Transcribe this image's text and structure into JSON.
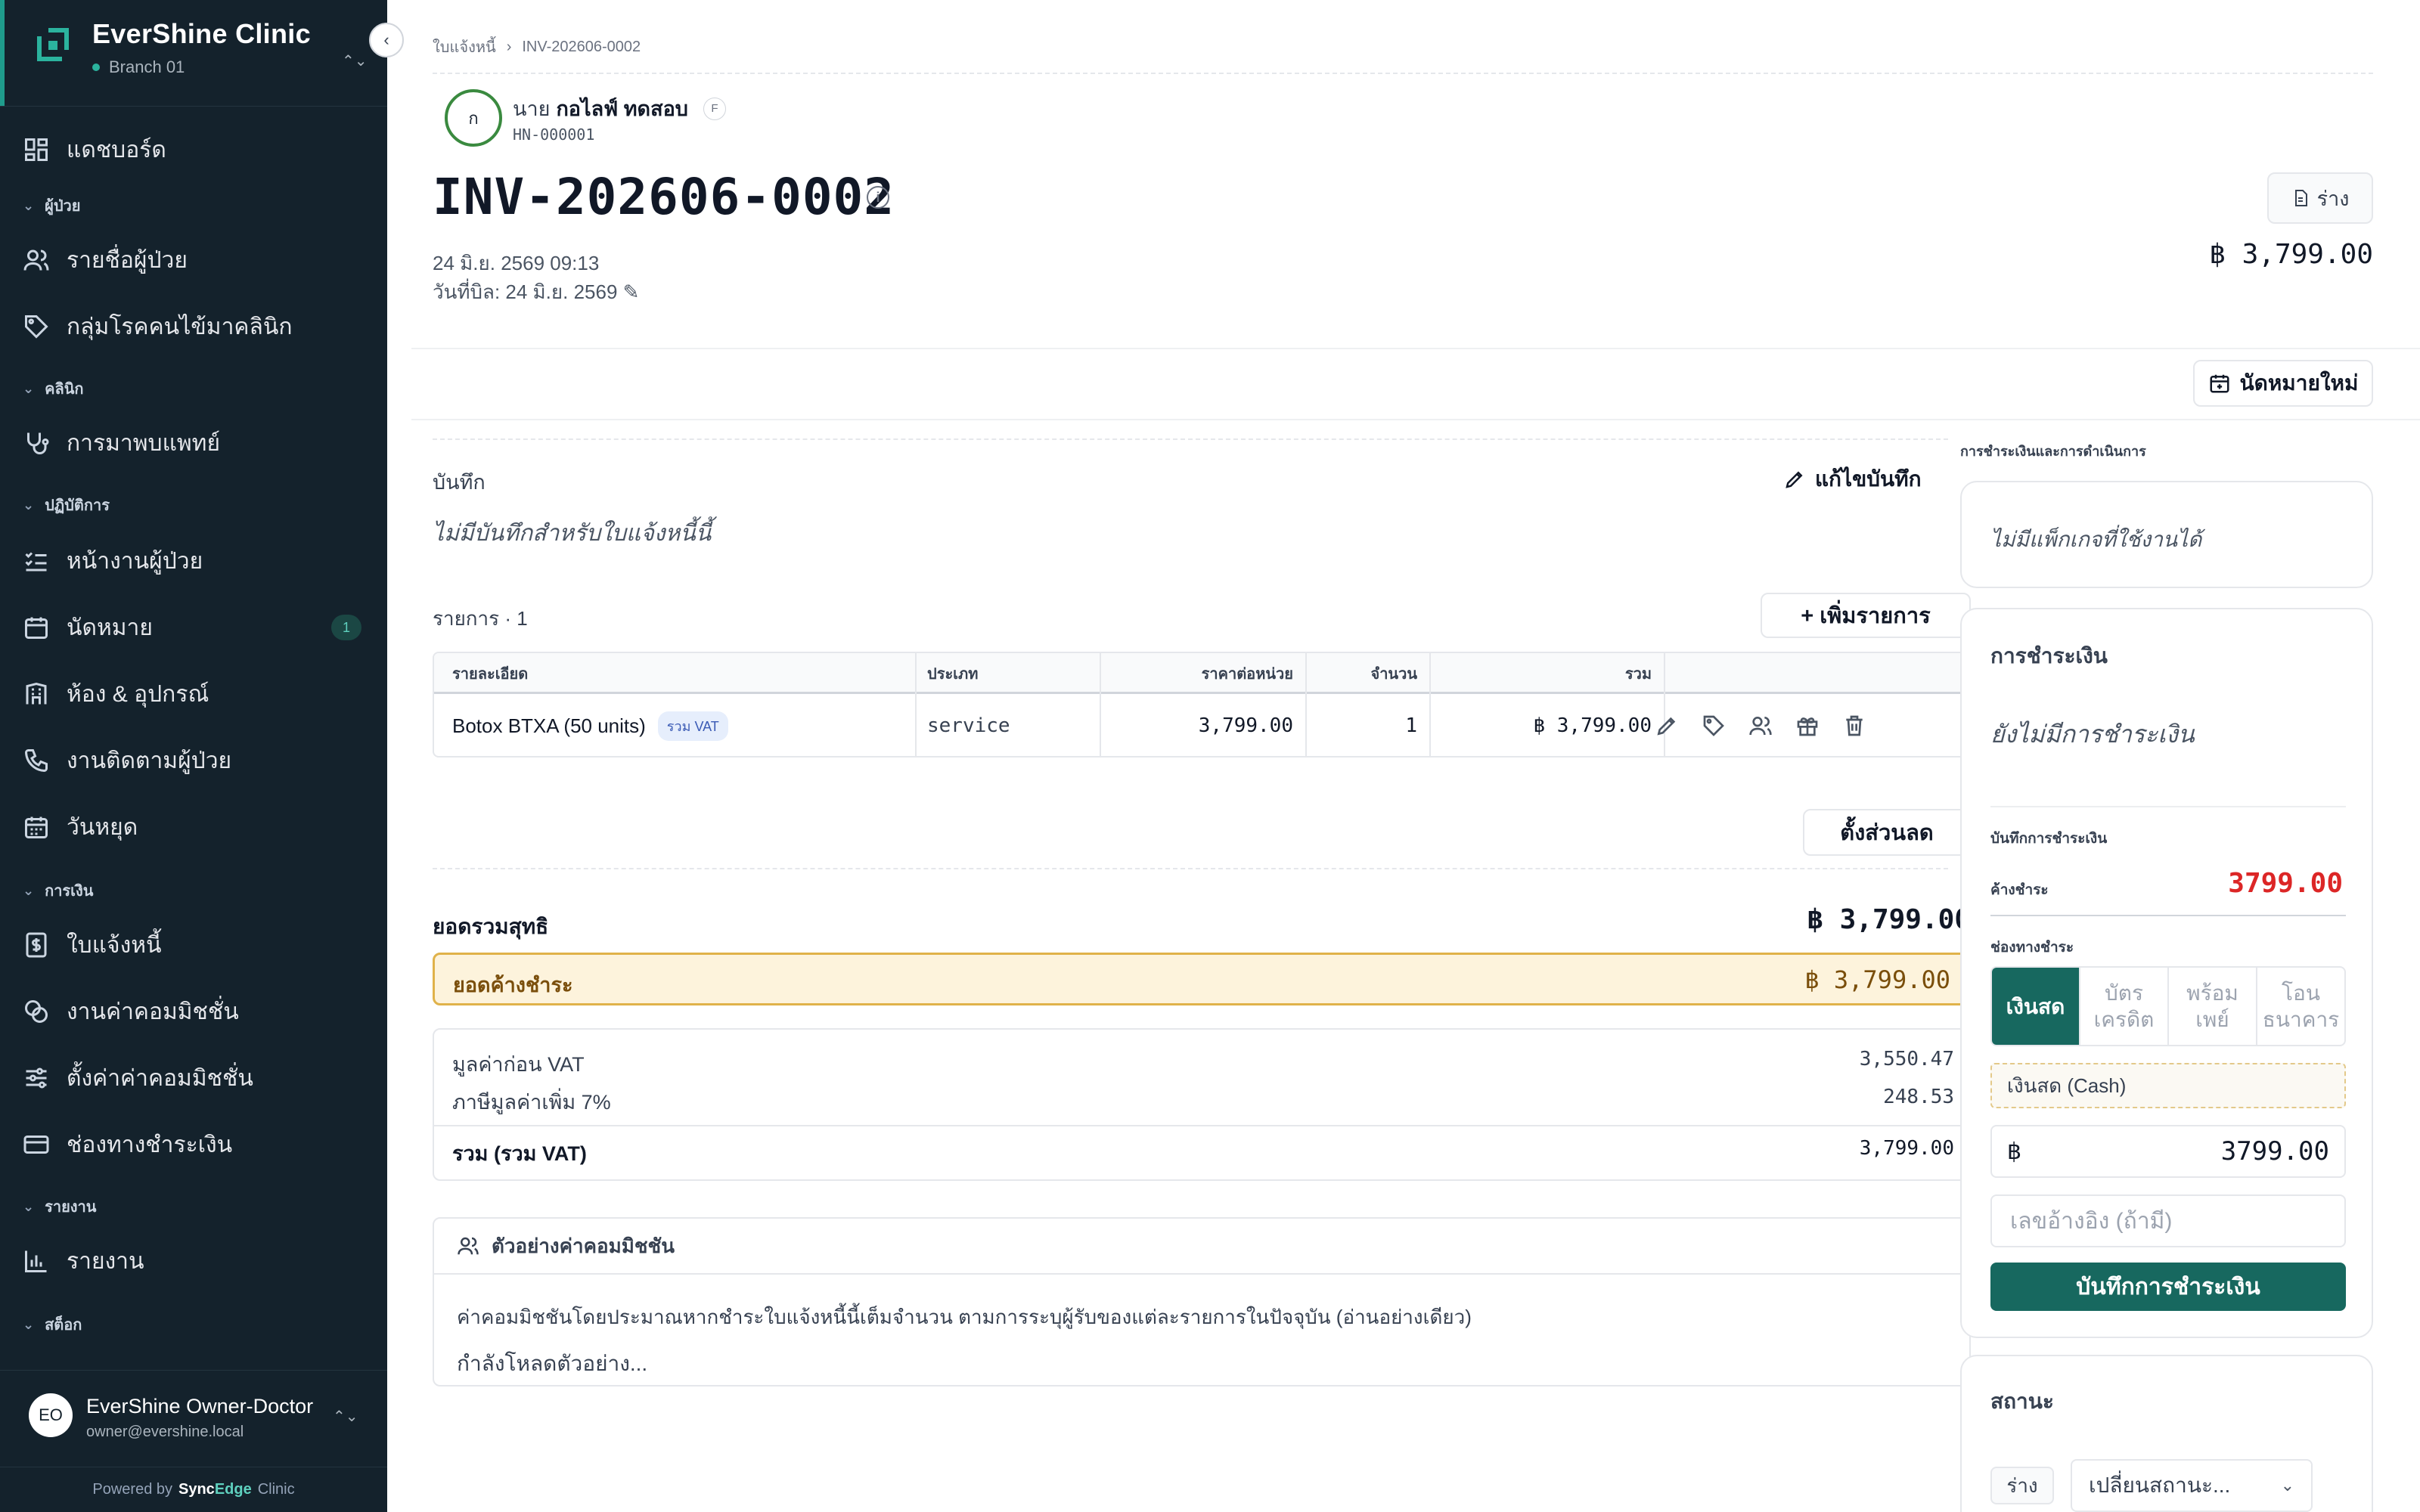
{
  "sidebar": {
    "brand_name": "EverShine Clinic",
    "branch": "Branch 01",
    "sections": {
      "patients": "ผู้ป่วย",
      "clinic": "คลินิก",
      "operations": "ปฏิบัติการ",
      "finance": "การเงิน",
      "reports": "รายงาน",
      "stock": "สต็อก"
    },
    "items": {
      "dashboard": "แดชบอร์ด",
      "patient_list": "รายชื่อผู้ป่วย",
      "patient_groups": "กลุ่มโรคคนไข้มาคลินิก",
      "doctor_visits": "การมาพบแพทย์",
      "patient_worklist": "หน้างานผู้ป่วย",
      "appointments": "นัดหมาย",
      "appointments_badge": "1",
      "rooms": "ห้อง & อุปกรณ์",
      "followups": "งานติดตามผู้ป่วย",
      "holidays": "วันหยุด",
      "invoices": "ใบแจ้งหนี้",
      "commission_jobs": "งานค่าคอมมิชชั่น",
      "commission_settings": "ตั้งค่าค่าคอมมิชชั่น",
      "payment_channels": "ช่องทางชำระเงิน",
      "reports": "รายงาน"
    },
    "user": {
      "initials": "EO",
      "name": "EverShine Owner-Doctor",
      "email": "owner@evershine.local"
    },
    "powered_prefix": "Powered by",
    "powered_brand_a": "Sync",
    "powered_brand_b": "Edge",
    "powered_suffix": "Clinic"
  },
  "breadcrumb": {
    "parent": "ใบแจ้งหนี้",
    "current": "INV-202606-0002"
  },
  "patient": {
    "avatar_initial": "ก",
    "prefix": "นาย",
    "name": "กอไลฟ์ ทดสอบ",
    "tag": "F",
    "hn": "HN-000001"
  },
  "invoice": {
    "number": "INV-202606-0002",
    "datetime": "24 มิ.ย. 2569 09:13",
    "bill_date": "วันที่บิล: 24 มิ.ย. 2569 ✎",
    "status_button": "ร่าง",
    "header_total": "฿ 3,799.00",
    "new_appointment": "นัดหมายใหม่"
  },
  "notes": {
    "title": "บันทึก",
    "edit": "แก้ไขบันทึก",
    "empty": "ไม่มีบันทึกสำหรับใบแจ้งหนี้นี้"
  },
  "items": {
    "title": "รายการ · 1",
    "add_button": "+ เพิ่มรายการ",
    "columns": {
      "desc": "รายละเอียด",
      "type": "ประเภท",
      "unit_price": "ราคาต่อหน่วย",
      "qty": "จำนวน",
      "total": "รวม"
    },
    "rows": [
      {
        "desc": "Botox BTXA (50 units)",
        "vat_tag": "รวม VAT",
        "type": "service",
        "unit_price": "3,799.00",
        "qty": "1",
        "total": "฿ 3,799.00"
      }
    ]
  },
  "discount_button": "ตั้งส่วนลด",
  "totals": {
    "net_label": "ยอดรวมสุทธิ",
    "net_value": "฿ 3,799.00",
    "outstanding_label": "ยอดค้างชำระ",
    "outstanding_value": "฿ 3,799.00",
    "pre_vat_label": "มูลค่าก่อน VAT",
    "pre_vat_value": "3,550.47",
    "vat_label": "ภาษีมูลค่าเพิ่ม 7%",
    "vat_value": "248.53",
    "total_label": "รวม (รวม VAT)",
    "total_value": "3,799.00"
  },
  "commission": {
    "title": "ตัวอย่างค่าคอมมิชชัน",
    "description": "ค่าคอมมิชชันโดยประมาณหากชำระใบแจ้งหนี้นี้เต็มจำนวน ตามการระบุผู้รับของแต่ละรายการในปัจจุบัน (อ่านอย่างเดียว)",
    "loading": "กำลังโหลดตัวอย่าง..."
  },
  "payment_panel": {
    "section_title": "การชำระเงินและการดำเนินการ",
    "packages_empty": "ไม่มีแพ็กเกจที่ใช้งานได้",
    "title": "การชำระเงิน",
    "empty": "ยังไม่มีการชำระเงิน",
    "record_title": "บันทึกการชำระเงิน",
    "due_label": "ค้างชำระ",
    "due_value": "3799.00",
    "channel_label": "ช่องทางชำระ",
    "methods": [
      "เงินสด",
      "บัตร\nเครดิต",
      "พร้อม\nเพย์",
      "โอน\nธนาคาร"
    ],
    "selected_method_name": "เงินสด (Cash)",
    "currency": "฿",
    "amount": "3799.00",
    "ref_placeholder": "เลขอ้างอิง (ถ้ามี)",
    "save_button": "บันทึกการชำระเงิน"
  },
  "status_panel": {
    "title": "สถานะ",
    "current": "ร่าง",
    "change_placeholder": "เปลี่ยนสถานะ..."
  }
}
